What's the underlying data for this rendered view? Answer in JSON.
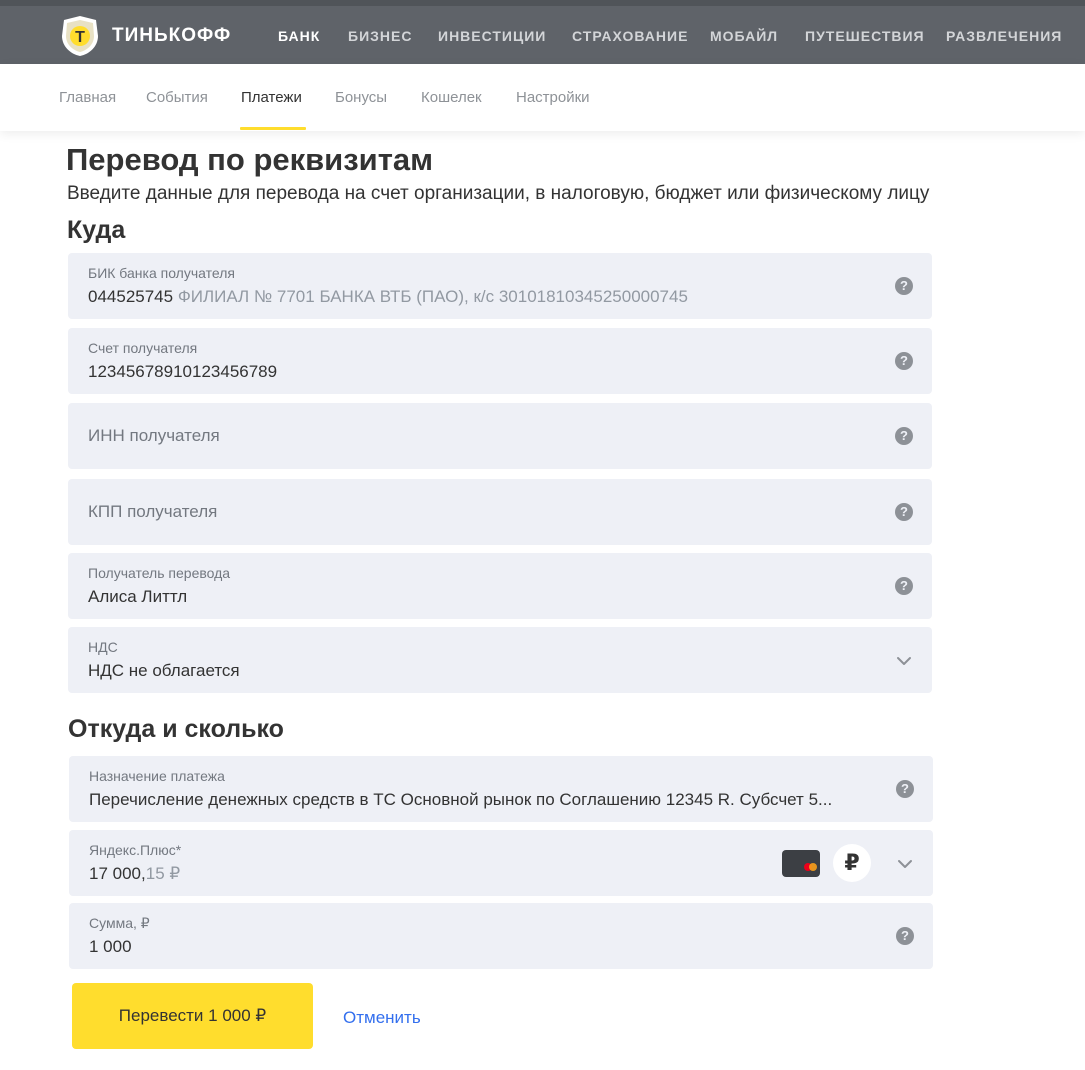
{
  "brand": {
    "name": "ТИНЬКОФФ"
  },
  "top_nav": [
    {
      "label": "БАНК",
      "active": true
    },
    {
      "label": "БИЗНЕС",
      "active": false
    },
    {
      "label": "ИНВЕСТИЦИИ",
      "active": false
    },
    {
      "label": "СТРАХОВАНИЕ",
      "active": false
    },
    {
      "label": "МОБАЙЛ",
      "active": false
    },
    {
      "label": "ПУТЕШЕСТВИЯ",
      "active": false
    },
    {
      "label": "РАЗВЛЕЧЕНИЯ",
      "active": false
    }
  ],
  "sub_nav": [
    {
      "label": "Главная",
      "active": false
    },
    {
      "label": "События",
      "active": false
    },
    {
      "label": "Платежи",
      "active": true
    },
    {
      "label": "Бонусы",
      "active": false
    },
    {
      "label": "Кошелек",
      "active": false
    },
    {
      "label": "Настройки",
      "active": false
    }
  ],
  "page": {
    "title": "Перевод по реквизитам",
    "subtitle": "Введите данные для перевода на счет организации, в налоговую, бюджет или физическому лицу"
  },
  "section_to": {
    "title": "Куда",
    "bik": {
      "label": "БИК банка получателя",
      "value": "044525745",
      "hint": "ФИЛИАЛ № 7701 БАНКА ВТБ (ПАО), к/с 30101810345250000745"
    },
    "account": {
      "label": "Счет получателя",
      "value": "12345678910123456789"
    },
    "inn": {
      "placeholder": "ИНН получателя"
    },
    "kpp": {
      "placeholder": "КПП получателя"
    },
    "recipient": {
      "label": "Получатель перевода",
      "value": "Алиса Литтл"
    },
    "vat": {
      "label": "НДС",
      "value": "НДС не облагается"
    }
  },
  "section_from": {
    "title": "Откуда и сколько",
    "purpose": {
      "label": "Назначение платежа",
      "value": "Перечисление денежных средств в ТС Основной рынок по Соглашению 12345 R. Субсчет 5..."
    },
    "source": {
      "label": "Яндекс.Плюс*",
      "balance_main": "17 000,",
      "balance_fraction": "15 ₽",
      "currency_symbol": "₽"
    },
    "amount": {
      "label": "Сумма, ₽",
      "value": "1 000"
    }
  },
  "actions": {
    "submit_label": "Перевести 1 000 ₽",
    "cancel_label": "Отменить"
  },
  "colors": {
    "header_bg": "#5f6369",
    "accent_yellow": "#ffdd2d",
    "field_bg": "#eef0f6",
    "link_blue": "#336fee"
  },
  "icons": {
    "help": "?"
  }
}
